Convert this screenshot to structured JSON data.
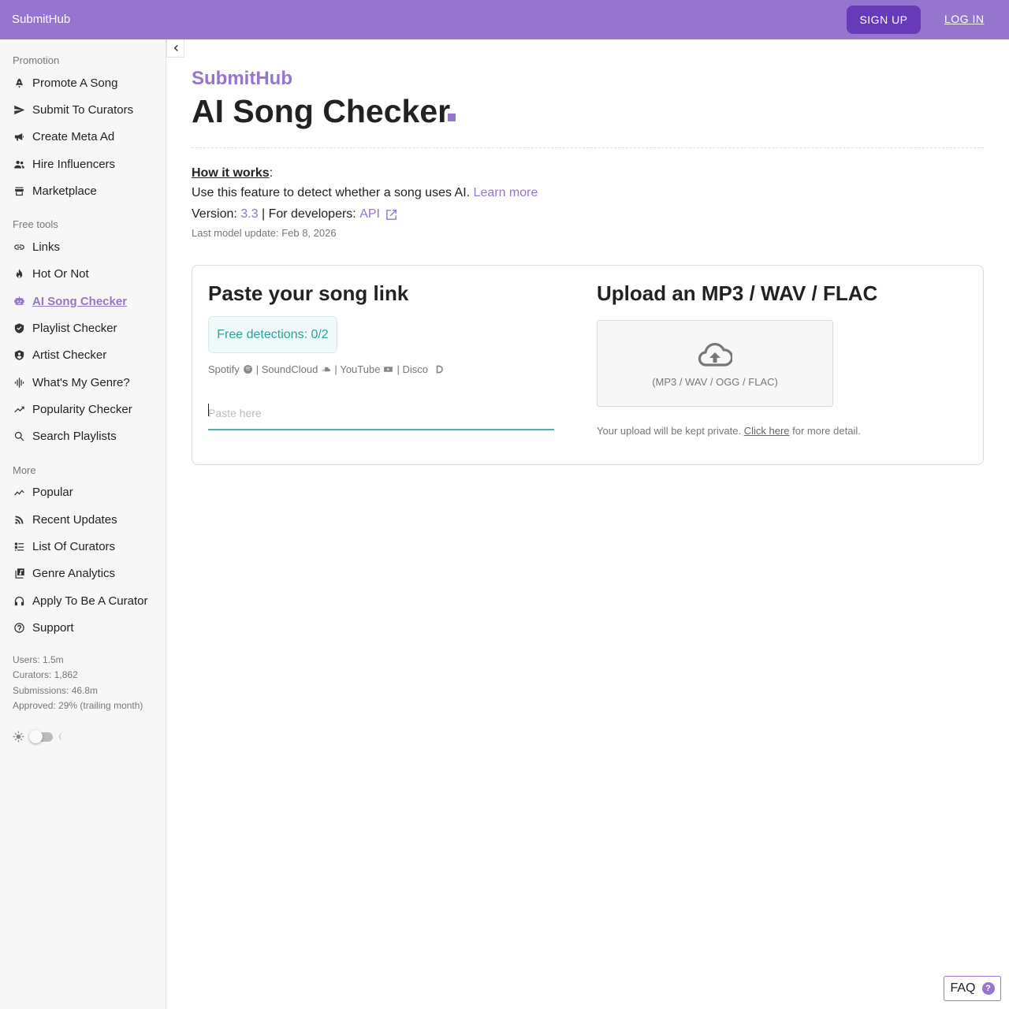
{
  "header": {
    "brand": "SubmitHub",
    "signup_label": "SIGN UP",
    "login_label": "LOG IN",
    "colors": {
      "bar": "#9575cd",
      "signup": "#673ab7"
    }
  },
  "sidebar": {
    "promotion_title": "Promotion",
    "promotion": [
      {
        "label": "Promote A Song",
        "icon": "rocket-icon"
      },
      {
        "label": "Submit To Curators",
        "icon": "send-icon"
      },
      {
        "label": "Create Meta Ad",
        "icon": "megaphone-icon"
      },
      {
        "label": "Hire Influencers",
        "icon": "people-icon"
      },
      {
        "label": "Marketplace",
        "icon": "storefront-icon"
      }
    ],
    "free_tools_title": "Free tools",
    "free_tools": [
      {
        "label": "Links",
        "icon": "link-icon"
      },
      {
        "label": "Hot Or Not",
        "icon": "fire-icon"
      },
      {
        "label": "AI Song Checker",
        "icon": "robot-icon",
        "active": true
      },
      {
        "label": "Playlist Checker",
        "icon": "shield-check-icon"
      },
      {
        "label": "Artist Checker",
        "icon": "shield-person-icon"
      },
      {
        "label": "What's My Genre?",
        "icon": "waveform-icon"
      },
      {
        "label": "Popularity Checker",
        "icon": "trending-up-icon"
      },
      {
        "label": "Search Playlists",
        "icon": "search-icon"
      }
    ],
    "more_title": "More",
    "more": [
      {
        "label": "Popular",
        "icon": "trend-icon"
      },
      {
        "label": "Recent Updates",
        "icon": "rss-icon"
      },
      {
        "label": "List Of Curators",
        "icon": "list-icon"
      },
      {
        "label": "Genre Analytics",
        "icon": "library-music-icon"
      },
      {
        "label": "Apply To Be A Curator",
        "icon": "headphones-icon"
      },
      {
        "label": "Support",
        "icon": "help-circle-icon"
      }
    ],
    "stats": [
      "Users: 1.5m",
      "Curators: 1,862",
      "Submissions: 46.8m",
      "Approved: 29% (trailing month)"
    ]
  },
  "main": {
    "brand_sub": "SubmitHub",
    "title": "AI Song Checker",
    "how_label": "How it works",
    "how_colon": ":",
    "description": "Use this feature to detect whether a song uses AI.",
    "learn_more": "Learn more",
    "version_prefix": "Version:",
    "version": "3.3",
    "developers_prefix": "| For developers:",
    "api_label": "API",
    "model_update": "Last model update: Feb 8, 2026",
    "accent": "#9575cd"
  },
  "paste_card": {
    "title": "Paste your song link",
    "free_detections": "Free detections: 0/2",
    "platforms": [
      "Spotify",
      "SoundCloud",
      "YouTube",
      "Disco"
    ],
    "separator": "|",
    "input_placeholder": "Paste here",
    "input_value": ""
  },
  "upload_card": {
    "title": "Upload an MP3 / WAV / FLAC",
    "types": "(MP3 / WAV / OGG / FLAC)",
    "privacy_prefix": "Your upload will be kept private.",
    "privacy_link": "Click here",
    "privacy_suffix": "for more detail."
  },
  "faq_label": "FAQ",
  "faq_icon": "?"
}
